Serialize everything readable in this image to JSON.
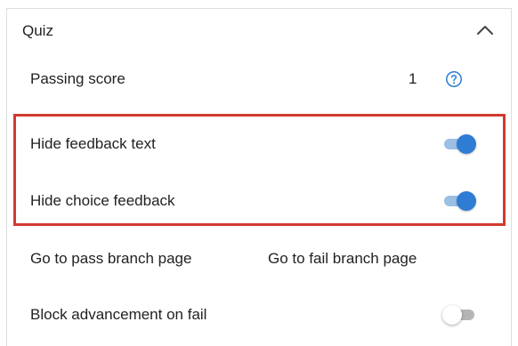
{
  "section": {
    "title": "Quiz",
    "expanded": true
  },
  "passing_score": {
    "label": "Passing score",
    "value": "1",
    "help_icon": "question-circle-icon"
  },
  "hide_feedback_text": {
    "label": "Hide feedback text",
    "on": true
  },
  "hide_choice_feedback": {
    "label": "Hide choice feedback",
    "on": true
  },
  "branch": {
    "pass_label": "Go to pass branch page",
    "fail_label": "Go to fail branch page"
  },
  "block_advancement": {
    "label": "Block advancement on fail",
    "on": false
  },
  "colors": {
    "accent": "#2f7cd4",
    "highlight": "#d23a2f"
  }
}
